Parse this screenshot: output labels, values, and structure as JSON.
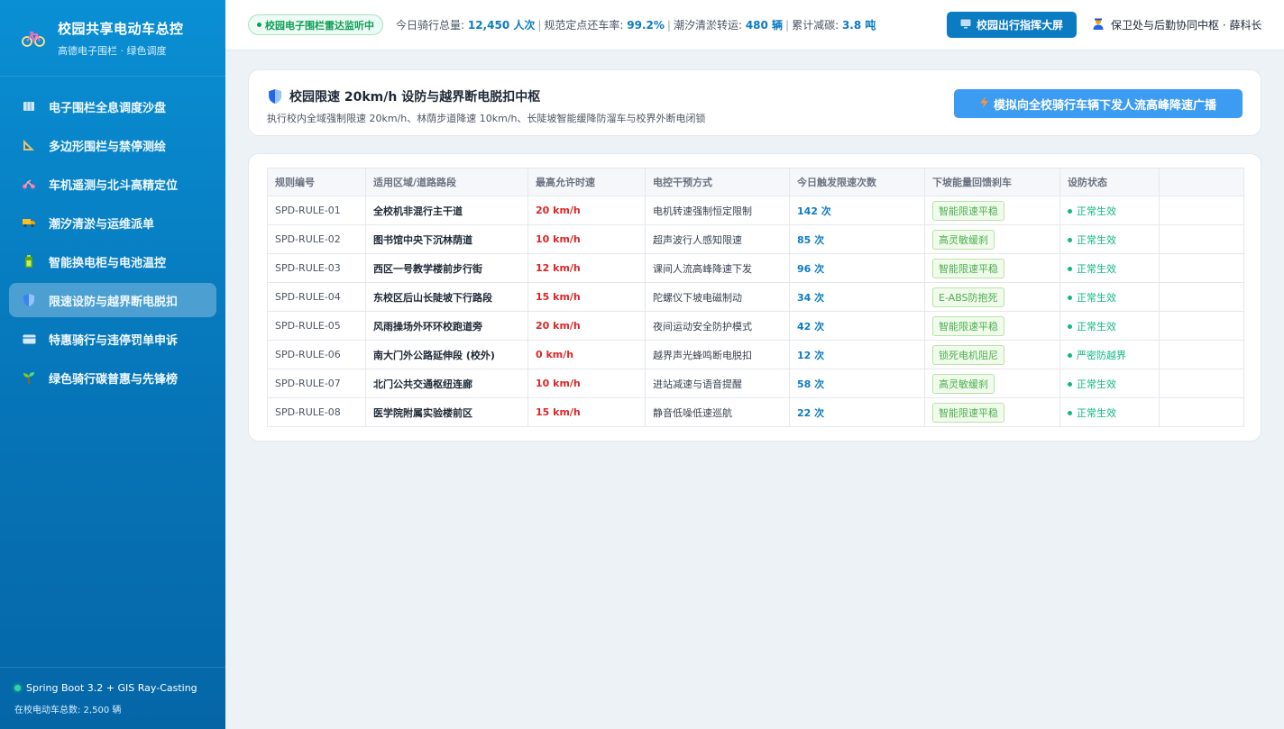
{
  "brand": {
    "title": "校园共享电动车总控",
    "subtitle": "高德电子围栏 · 绿色调度",
    "icon": "bicycle-icon"
  },
  "sidebar": {
    "items": [
      {
        "label": "电子围栏全息调度沙盘",
        "icon": "map-icon",
        "active": false
      },
      {
        "label": "多边形围栏与禁停测绘",
        "icon": "ruler-triangle-icon",
        "active": false
      },
      {
        "label": "车机遥测与北斗高精定位",
        "icon": "scooter-icon",
        "active": false
      },
      {
        "label": "潮汐清淤与运维派单",
        "icon": "truck-icon",
        "active": false
      },
      {
        "label": "智能换电柜与电池温控",
        "icon": "battery-icon",
        "active": false
      },
      {
        "label": "限速设防与越界断电脱扣",
        "icon": "shield-icon",
        "active": true
      },
      {
        "label": "特惠骑行与违停罚单申诉",
        "icon": "card-icon",
        "active": false
      },
      {
        "label": "绿色骑行碳普惠与先锋榜",
        "icon": "sprout-icon",
        "active": false
      }
    ],
    "footer": {
      "tech": "Spring Boot 3.2 + GIS Ray-Casting",
      "fleet": "在校电动车总数: 2,500 辆"
    }
  },
  "topbar": {
    "radar_badge": "校园电子围栏雷达监听中",
    "stats": [
      {
        "label": "今日骑行总量: ",
        "value": "12,450 人次"
      },
      {
        "label": "规范定点还车率: ",
        "value": "99.2%"
      },
      {
        "label": "潮汐清淤转运: ",
        "value": "480 辆"
      },
      {
        "label": "累计减碳: ",
        "value": "3.8 吨"
      }
    ],
    "screen_button": "校园出行指挥大屏",
    "user": "保卫处与后勤协同中枢 · 薛科长"
  },
  "header": {
    "title": "校园限速 20km/h 设防与越界断电脱扣中枢",
    "subtitle": "执行校内全域强制限速 20km/h、林荫步道降速 10km/h、长陡坡智能缓降防溜车与校界外断电闭锁",
    "broadcast_button": "模拟向全校骑行车辆下发人流高峰降速广播"
  },
  "table": {
    "columns": [
      "规则编号",
      "适用区域/道路路段",
      "最高允许时速",
      "电控干预方式",
      "今日触发限速次数",
      "下坡能量回馈刹车",
      "设防状态"
    ],
    "rows": [
      {
        "id": "SPD-RULE-01",
        "area": "全校机非混行主干道",
        "speed": "20 km/h",
        "method": "电机转速强制恒定限制",
        "count": "142 次",
        "brake": "智能限速平稳",
        "status": "正常生效"
      },
      {
        "id": "SPD-RULE-02",
        "area": "图书馆中央下沉林荫道",
        "speed": "10 km/h",
        "method": "超声波行人感知限速",
        "count": "85 次",
        "brake": "高灵敏缓刹",
        "status": "正常生效"
      },
      {
        "id": "SPD-RULE-03",
        "area": "西区一号教学楼前步行街",
        "speed": "12 km/h",
        "method": "课间人流高峰降速下发",
        "count": "96 次",
        "brake": "智能限速平稳",
        "status": "正常生效"
      },
      {
        "id": "SPD-RULE-04",
        "area": "东校区后山长陡坡下行路段",
        "speed": "15 km/h",
        "method": "陀螺仪下坡电磁制动",
        "count": "34 次",
        "brake": "E-ABS防抱死",
        "status": "正常生效"
      },
      {
        "id": "SPD-RULE-05",
        "area": "风雨操场外环环校跑道旁",
        "speed": "20 km/h",
        "method": "夜间运动安全防护模式",
        "count": "42 次",
        "brake": "智能限速平稳",
        "status": "正常生效"
      },
      {
        "id": "SPD-RULE-06",
        "area": "南大门外公路延伸段 (校外)",
        "speed": "0 km/h",
        "method": "越界声光蜂鸣断电脱扣",
        "count": "12 次",
        "brake": "锁死电机阻尼",
        "status": "严密防越界"
      },
      {
        "id": "SPD-RULE-07",
        "area": "北门公共交通枢纽连廊",
        "speed": "10 km/h",
        "method": "进站减速与语音提醒",
        "count": "58 次",
        "brake": "高灵敏缓刹",
        "status": "正常生效"
      },
      {
        "id": "SPD-RULE-08",
        "area": "医学院附属实验楼前区",
        "speed": "15 km/h",
        "method": "静音低噪低速巡航",
        "count": "22 次",
        "brake": "智能限速平稳",
        "status": "正常生效"
      }
    ]
  }
}
